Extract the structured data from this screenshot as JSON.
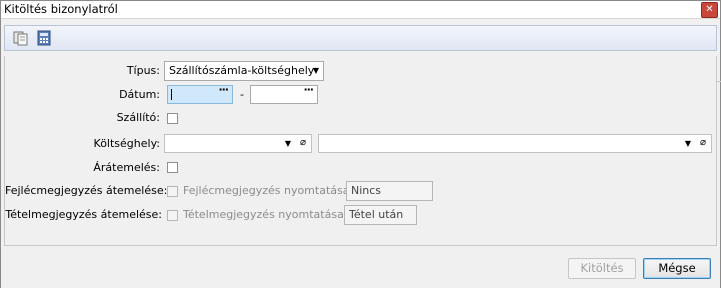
{
  "window": {
    "title": "Kitöltés bizonylatról",
    "close_glyph": "✕"
  },
  "toolbar": {
    "icons": [
      "documents-icon",
      "calculator-icon"
    ]
  },
  "form": {
    "tipus": {
      "label": "Típus:",
      "value": "Szállítószámla-költséghely"
    },
    "datum": {
      "label": "Dátum:",
      "from": "",
      "to": "",
      "separator": "-",
      "picker_glyph": "···"
    },
    "szallito": {
      "label": "Szállító:",
      "checked": false
    },
    "koltseghely": {
      "label": "Költséghely:",
      "value1": "",
      "value2": ""
    },
    "aratemeles": {
      "label": "Árátemelés:",
      "checked": false
    },
    "fejlec": {
      "label": "Fejlécmegjegyzés átemelése:",
      "print_label": "Fejlécmegjegyzés nyomtatása:",
      "print_value": "Nincs"
    },
    "tetel": {
      "label": "Tételmegjegyzés átemelése:",
      "print_label": "Tételmegjegyzés nyomtatása:",
      "print_value": "Tétel után"
    }
  },
  "buttons": {
    "fill": "Kitöltés",
    "cancel": "Mégse"
  }
}
